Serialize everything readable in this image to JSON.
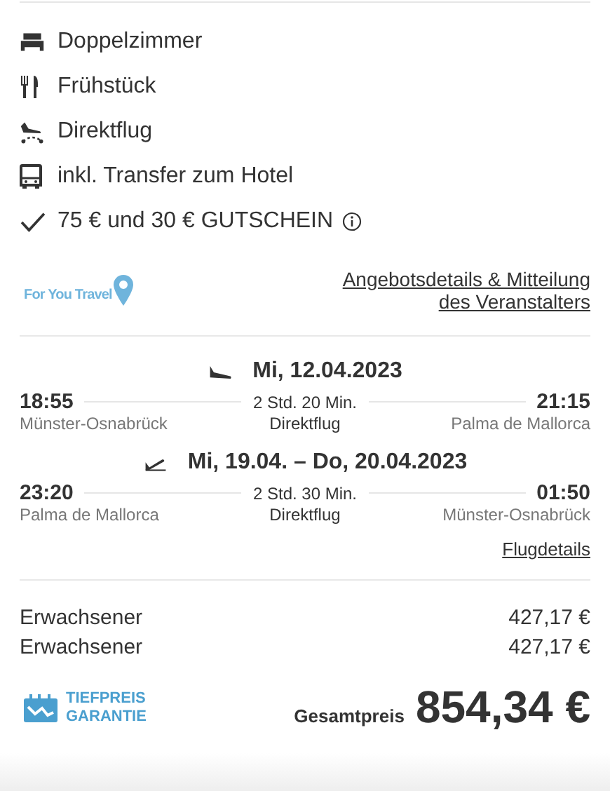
{
  "features": [
    {
      "kind": "bed",
      "label": "Doppelzimmer",
      "info": false
    },
    {
      "kind": "meal",
      "label": "Frühstück",
      "info": false
    },
    {
      "kind": "flight",
      "label": "Direktflug",
      "info": false
    },
    {
      "kind": "bus",
      "label": "inkl. Transfer zum Hotel",
      "info": false
    },
    {
      "kind": "check",
      "label": "75 € und 30 € GUTSCHEIN",
      "info": true
    }
  ],
  "operator": {
    "logo_text": "For You Travel",
    "link_lines": [
      "Angebotsdetails & Mitteilung",
      "des Veranstalters"
    ]
  },
  "flights": [
    {
      "kind": "outbound",
      "date": "Mi, 12.04.2023",
      "depart_time": "18:55",
      "depart_airport": "Münster-Osnabrück",
      "duration": "2 Std. 20 Min.",
      "type": "Direktflug",
      "arrive_time": "21:15",
      "arrive_airport": "Palma de Mallorca"
    },
    {
      "kind": "return",
      "date": "Mi, 19.04. – Do, 20.04.2023",
      "depart_time": "23:20",
      "depart_airport": "Palma de Mallorca",
      "duration": "2 Std. 30 Min.",
      "type": "Direktflug",
      "arrive_time": "01:50",
      "arrive_airport": "Münster-Osnabrück"
    }
  ],
  "flight_details_link": "Flugdetails",
  "prices": [
    {
      "label": "Erwachsener",
      "amount": "427,17 €"
    },
    {
      "label": "Erwachsener",
      "amount": "427,17 €"
    }
  ],
  "badge": {
    "line1": "TIEFPREIS",
    "line2": "GARANTIE"
  },
  "total": {
    "label": "Gesamtpreis",
    "amount": "854,34 €"
  }
}
